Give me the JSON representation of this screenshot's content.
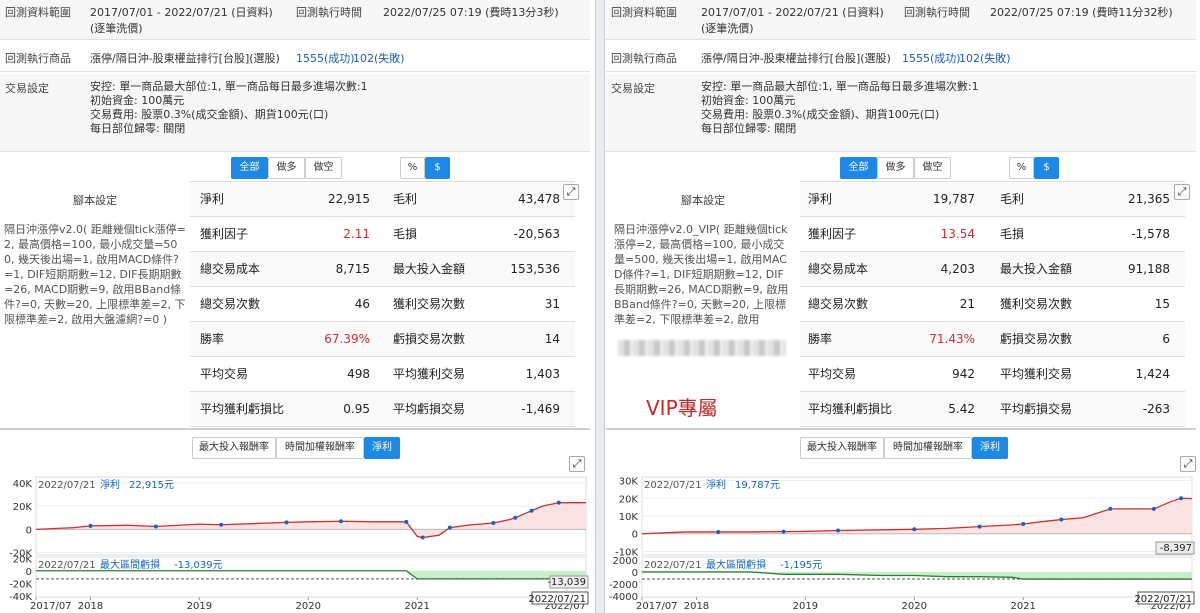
{
  "colors": {
    "accent": "#1e88e5",
    "profit_line": "#d32f2f",
    "point": "#1565c0",
    "drawdown_line": "#2e7d32",
    "drawdown_fill": "#c8f0c8",
    "highlight": "#d32f2f",
    "vip": "#c62828"
  },
  "left": {
    "range_label": "回測資料範圍",
    "range_value": "2017/07/01 - 2022/07/21 (日資料)",
    "range_sub": "(逐筆洗價)",
    "exec_time_label": "回測執行時間",
    "exec_time_value": "2022/07/25 07:19 (費時13分3秒)",
    "product_label": "回測執行商品",
    "product_value": "漲停/隔日沖-股東權益排行[台股](選股)",
    "product_success": "1555(成功)",
    "product_fail": "102(失敗)",
    "trade_label": "交易設定",
    "trade_lines": [
      "安控: 單一商品最大部位:1, 單一商品每日最多進場次數:1",
      "初始資金: 100萬元",
      "交易費用: 股票0.3%(成交金額)、期貨100元(口)",
      "每日部位歸零: 關閉"
    ],
    "filter_buttons": [
      "全部",
      "做多",
      "做空"
    ],
    "unit_buttons": [
      "%",
      "$"
    ],
    "script_header": "腳本設定",
    "script_text": "隔日沖漲停v2.0( 距離幾個tick漲停=2, 最高價格=100, 最小成交量=500, 幾天後出場=1, 啟用MACD條件?=1, DIF短期期數=12, DIF長期期數=26, MACD期數=9, 啟用BBand條件?=0, 天數=20, 上限標準差=2, 下限標準差=2, 啟用大盤濾網?=0 )",
    "stats": [
      {
        "l1": "淨利",
        "v1": "22,915",
        "l2": "毛利",
        "v2": "43,478"
      },
      {
        "l1": "獲利因子",
        "v1": "2.11",
        "l2": "毛損",
        "v2": "-20,563"
      },
      {
        "l1": "總交易成本",
        "v1": "8,715",
        "l2": "最大投入金額",
        "v2": "153,536"
      },
      {
        "l1": "總交易次數",
        "v1": "46",
        "l2": "獲利交易次數",
        "v2": "31"
      },
      {
        "l1": "勝率",
        "v1": "67.39%",
        "l2": "虧損交易次數",
        "v2": "14"
      },
      {
        "l1": "平均交易",
        "v1": "498",
        "l2": "平均獲利交易",
        "v2": "1,403"
      },
      {
        "l1": "平均獲利虧損比",
        "v1": "0.95",
        "l2": "平均虧損交易",
        "v2": "-1,469"
      }
    ],
    "chart_tabs": [
      "最大投入報酬率",
      "時間加權報酬率",
      "淨利"
    ],
    "chart_data": {
      "type": "line",
      "x_labels": [
        "2017/07",
        "2018",
        "2019",
        "2020",
        "2021",
        "2022/07"
      ],
      "profit_axis": [
        "40K",
        "20K",
        "0",
        "-20K"
      ],
      "drawdown_axis": [
        "20K",
        "0",
        "-20K",
        "-40K"
      ],
      "x": [
        2017.5,
        2017.85,
        2018.0,
        2018.35,
        2018.6,
        2019.0,
        2019.2,
        2019.5,
        2019.8,
        2020.0,
        2020.3,
        2020.6,
        2020.9,
        2021.0,
        2021.05,
        2021.2,
        2021.3,
        2021.5,
        2021.7,
        2021.85,
        2021.9,
        2022.0,
        2022.05,
        2022.15,
        2022.3,
        2022.55
      ],
      "profit": [
        0,
        1500,
        3000,
        3500,
        2500,
        4500,
        4000,
        5000,
        6000,
        6500,
        7000,
        6500,
        6500,
        -6000,
        -7000,
        -5000,
        1500,
        4000,
        5500,
        8500,
        10000,
        14000,
        16000,
        20000,
        23000,
        22915
      ],
      "drawdown": [
        0,
        0,
        0,
        0,
        0,
        0,
        0,
        0,
        0,
        0,
        0,
        0,
        0,
        -13039,
        -13039,
        -13039,
        -13039,
        -13039,
        -13039,
        -13039,
        -13039,
        -13039,
        -13039,
        -13039,
        -13039,
        -13039
      ],
      "profit_label_date": "2022/07/21",
      "profit_label_name": "淨利",
      "profit_label_value": "22,915元",
      "drawdown_label_date": "2022/07/21",
      "drawdown_label_name": "最大區間虧損",
      "drawdown_label_value": "-13,039元",
      "drawdown_end_value": "-13,039",
      "end_date_label": "2022/07/21"
    }
  },
  "right": {
    "range_label": "回測資料範圍",
    "range_value": "2017/07/01 - 2022/07/21 (日資料)",
    "range_sub": "(逐筆洗價)",
    "exec_time_label": "回測執行時間",
    "exec_time_value": "2022/07/25 07:19 (費時11分32秒)",
    "product_label": "回測執行商品",
    "product_value": "漲停/隔日沖-股東權益排行[台股](選股)",
    "product_success": "1555(成功)",
    "product_fail": "102(失敗)",
    "trade_label": "交易設定",
    "trade_lines": [
      "安控: 單一商品最大部位:1, 單一商品每日最多進場次數:1",
      "初始資金: 100萬元",
      "交易費用: 股票0.3%(成交金額)、期貨100元(口)",
      "每日部位歸零: 關閉"
    ],
    "filter_buttons": [
      "全部",
      "做多",
      "做空"
    ],
    "unit_buttons": [
      "%",
      "$"
    ],
    "script_header": "腳本設定",
    "script_text": "隔日沖漲停v2.0_VIP( 距離幾個tick漲停=2, 最高價格=100, 最小成交量=500, 幾天後出場=1, 啟用MACD條件?=1, DIF短期期數=12, DIF長期期數=26, MACD期數=9, 啟用BBand條件?=0, 天數=20, 上限標準差=2, 下限標準差=2, 啟用",
    "vip_label": "VIP專屬",
    "stats": [
      {
        "l1": "淨利",
        "v1": "19,787",
        "l2": "毛利",
        "v2": "21,365"
      },
      {
        "l1": "獲利因子",
        "v1": "13.54",
        "l2": "毛損",
        "v2": "-1,578"
      },
      {
        "l1": "總交易成本",
        "v1": "4,203",
        "l2": "最大投入金額",
        "v2": "91,188"
      },
      {
        "l1": "總交易次數",
        "v1": "21",
        "l2": "獲利交易次數",
        "v2": "15"
      },
      {
        "l1": "勝率",
        "v1": "71.43%",
        "l2": "虧損交易次數",
        "v2": "6"
      },
      {
        "l1": "平均交易",
        "v1": "942",
        "l2": "平均獲利交易",
        "v2": "1,424"
      },
      {
        "l1": "平均獲利虧損比",
        "v1": "5.42",
        "l2": "平均虧損交易",
        "v2": "-263"
      }
    ],
    "chart_tabs": [
      "最大投入報酬率",
      "時間加權報酬率",
      "淨利"
    ],
    "chart_data": {
      "type": "line",
      "x_labels": [
        "2017/07",
        "2018",
        "2019",
        "2020",
        "2021",
        "2022/07"
      ],
      "profit_axis": [
        "30K",
        "20K",
        "10K",
        "0",
        "-10K"
      ],
      "drawdown_axis": [
        "2000",
        "0",
        "-2000",
        "-4000"
      ],
      "x": [
        2017.5,
        2017.9,
        2018.2,
        2018.5,
        2018.8,
        2019.0,
        2019.3,
        2019.7,
        2020.0,
        2020.3,
        2020.6,
        2020.9,
        2021.0,
        2021.2,
        2021.35,
        2021.55,
        2021.8,
        2022.0,
        2022.2,
        2022.35,
        2022.45,
        2022.55
      ],
      "profit": [
        0,
        1000,
        1000,
        1000,
        1200,
        1300,
        1800,
        2200,
        2500,
        3000,
        4000,
        5000,
        5500,
        7000,
        8000,
        9000,
        14000,
        14000,
        14000,
        18000,
        20000,
        19787
      ],
      "drawdown": [
        0,
        0,
        0,
        0,
        -400,
        -400,
        -400,
        -600,
        -600,
        -800,
        -800,
        -900,
        -1195,
        -1195,
        -1195,
        -1195,
        -1195,
        -1195,
        -1195,
        -1195,
        -1195,
        -1195
      ],
      "profit_label_date": "2022/07/21",
      "profit_label_name": "淨利",
      "profit_label_value": "19,787元",
      "drawdown_label_date": "2022/07/21",
      "drawdown_label_name": "最大區間虧損",
      "drawdown_label_value": "-1,195元",
      "drawdown_end_value": "-8,397",
      "end_date_label": "2022/07/21"
    }
  }
}
